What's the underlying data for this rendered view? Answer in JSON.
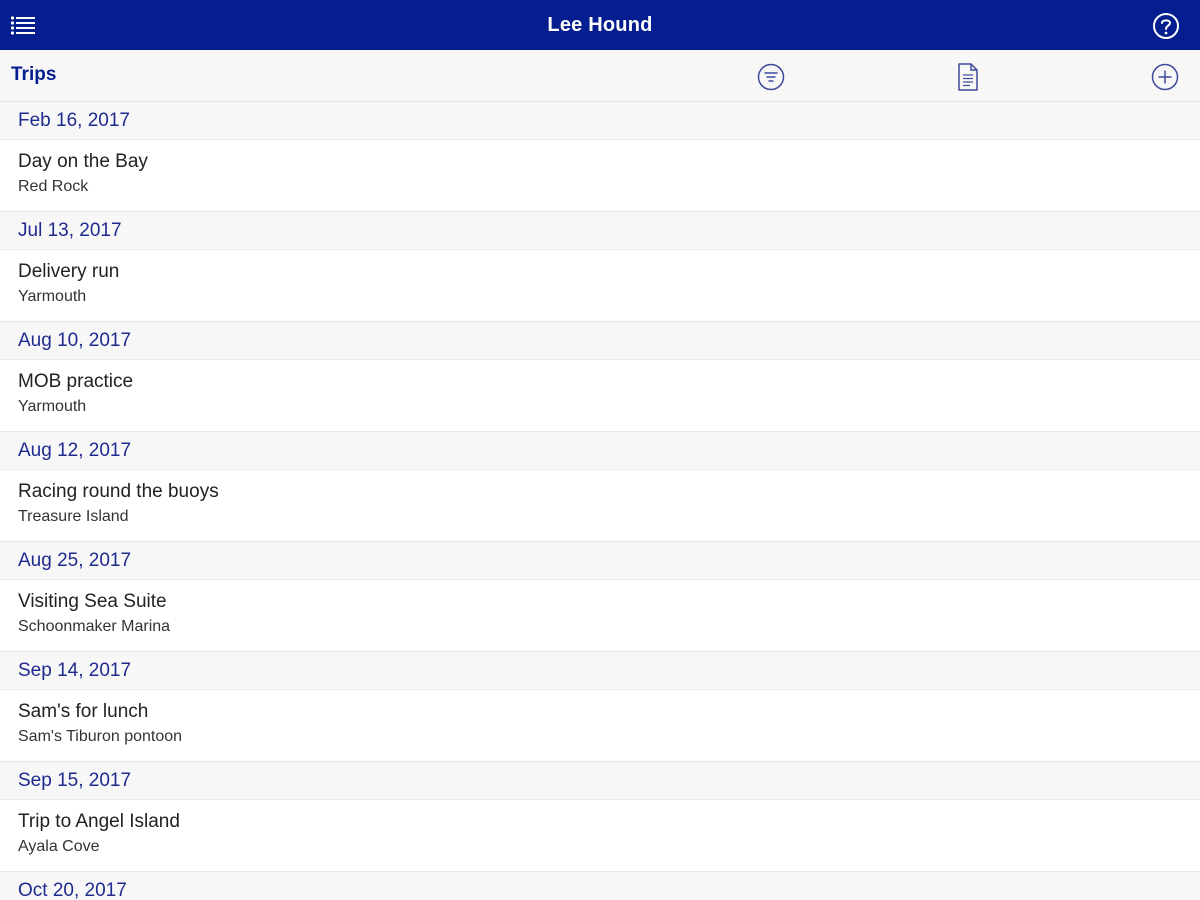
{
  "app": {
    "title": "Lee Hound"
  },
  "toolbar": {
    "section_title": "Trips"
  },
  "icons": {
    "menu": "list-menu-icon",
    "help": "question-circle-icon",
    "filter": "filter-circle-icon",
    "document": "document-icon",
    "add": "plus-circle-icon"
  },
  "colors": {
    "header_bg": "#041d8f",
    "accent_text": "#1f2a8f",
    "section_bg": "#f7f7f7"
  },
  "trips": [
    {
      "date": "Feb 16, 2017",
      "name": "Day on the Bay",
      "location": "Red Rock"
    },
    {
      "date": "Jul 13, 2017",
      "name": "Delivery run",
      "location": "Yarmouth"
    },
    {
      "date": "Aug 10, 2017",
      "name": "MOB practice",
      "location": "Yarmouth"
    },
    {
      "date": "Aug 12, 2017",
      "name": "Racing round the buoys",
      "location": "Treasure Island"
    },
    {
      "date": "Aug 25, 2017",
      "name": "Visiting Sea Suite",
      "location": "Schoonmaker Marina"
    },
    {
      "date": "Sep 14, 2017",
      "name": "Sam's for lunch",
      "location": "Sam's Tiburon pontoon"
    },
    {
      "date": "Sep 15, 2017",
      "name": "Trip to Angel Island",
      "location": "Ayala Cove"
    },
    {
      "date": "Oct 20, 2017"
    }
  ]
}
